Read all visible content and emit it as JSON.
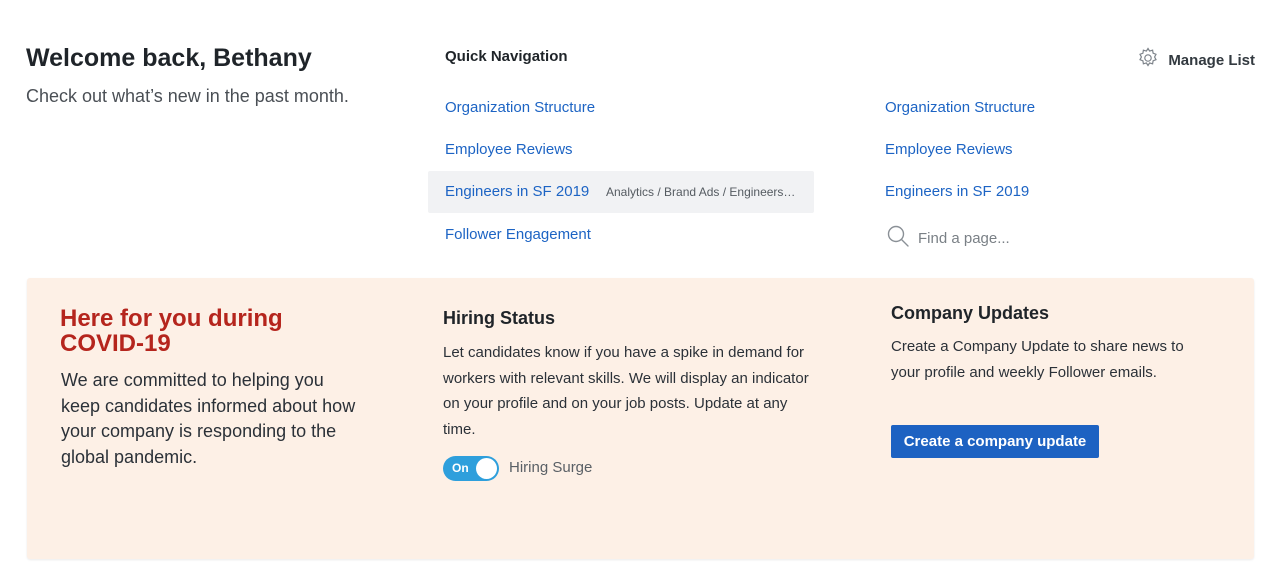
{
  "welcome": {
    "title": "Welcome back, Bethany",
    "subtitle": "Check out what’s new in the past month."
  },
  "quick_nav": {
    "title": "Quick Navigation",
    "left_links": [
      {
        "label": "Organization Structure"
      },
      {
        "label": "Employee Reviews"
      },
      {
        "label": "Engineers in SF 2019",
        "breadcrumb": "Analytics / Brand Ads / Engineers…"
      },
      {
        "label": "Follower Engagement"
      }
    ],
    "right_links": [
      {
        "label": "Organization Structure"
      },
      {
        "label": "Employee Reviews"
      },
      {
        "label": "Engineers in SF 2019"
      }
    ],
    "manage_label": "Manage List",
    "manage_icon": "gear-icon",
    "search": {
      "placeholder": "Find a page...",
      "value": "",
      "icon": "search-icon"
    }
  },
  "covid": {
    "title": "Here for you during COVID-19",
    "body": "We are committed to helping you keep candidates informed about how your company is responding to the global pandemic."
  },
  "hiring_status": {
    "title": "Hiring Status",
    "body": "Let candidates know if you have a spike in demand for workers with relevant skills. We will display an indicator on your profile and on your job posts. Update at any time.",
    "toggle_state": "On",
    "toggle_label": "Hiring Surge"
  },
  "company_updates": {
    "title": "Company Updates",
    "body": "Create a Company Update to share news to your profile and weekly Follower emails.",
    "button_label": "Create a company update"
  },
  "colors": {
    "link": "#1d64c4",
    "panel_bg": "#fdf0e6",
    "covid_title": "#b5251d",
    "toggle_on": "#2e9fdc",
    "button_bg": "#1d62c2"
  }
}
